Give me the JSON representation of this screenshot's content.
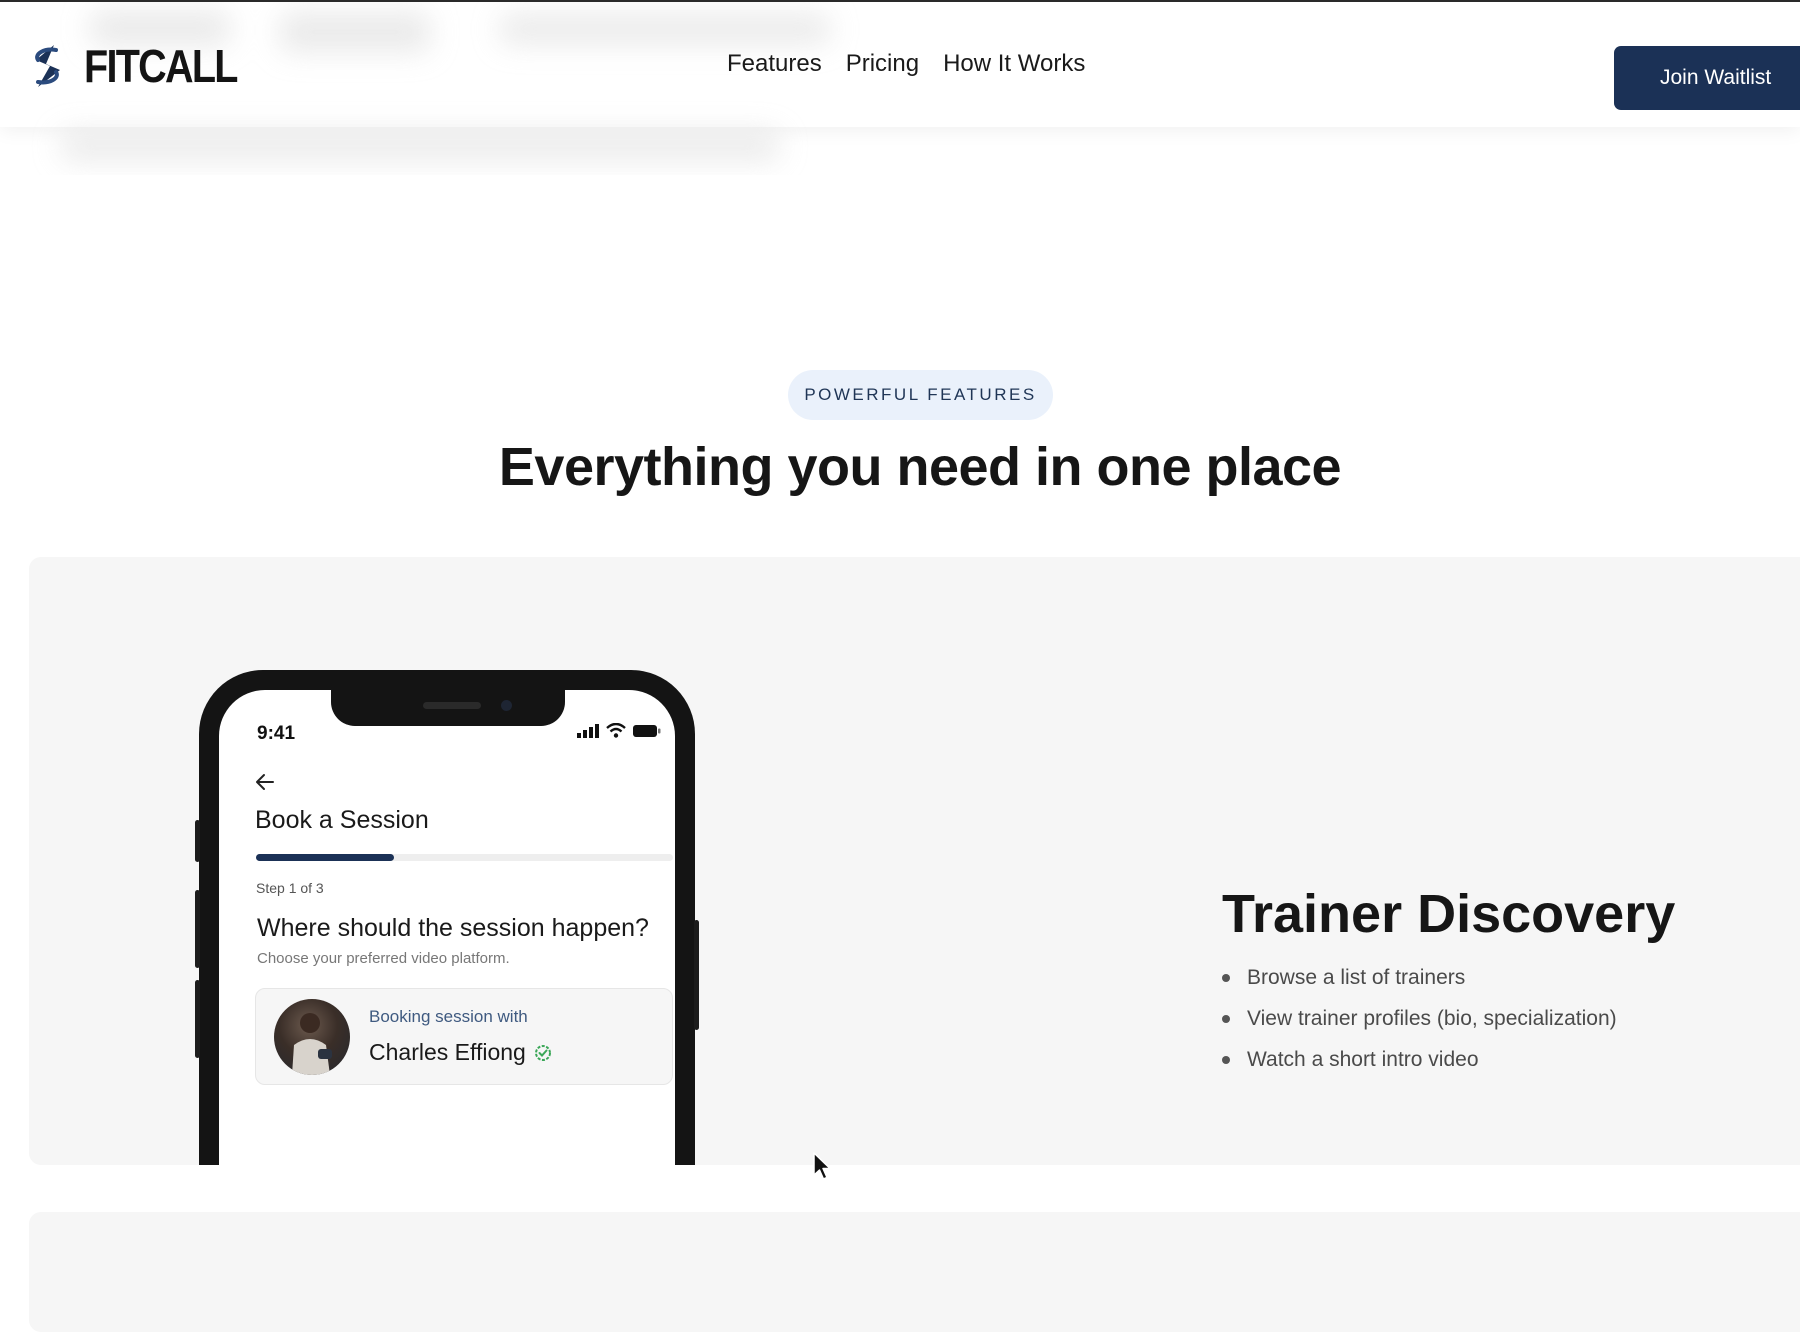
{
  "header": {
    "brand": "FITCALL",
    "nav": [
      "Features",
      "Pricing",
      "How It Works"
    ],
    "cta": "Join Waitlist"
  },
  "hero": {
    "badge": "POWERFUL FEATURES",
    "headline": "Everything you need in one place"
  },
  "phone": {
    "time": "9:41",
    "title": "Book a Session",
    "progress": 0.33,
    "step": "Step 1 of 3",
    "question": "Where should the session happen?",
    "question_sub": "Choose your preferred video platform.",
    "booking_label": "Booking session with",
    "trainer_name": "Charles Effiong"
  },
  "feature": {
    "title": "Trainer Discovery",
    "bullets": [
      "Browse a list of trainers",
      "View trainer profiles (bio, specialization)",
      "Watch a short intro video"
    ]
  },
  "colors": {
    "primary": "#1b3156",
    "badge_bg": "#eaf1fb",
    "card_bg": "#f6f6f6",
    "verified": "#3aa757"
  },
  "icons": [
    "logo-icon",
    "back-arrow-icon",
    "signal-icon",
    "wifi-icon",
    "battery-icon",
    "verified-icon",
    "cursor-icon"
  ]
}
